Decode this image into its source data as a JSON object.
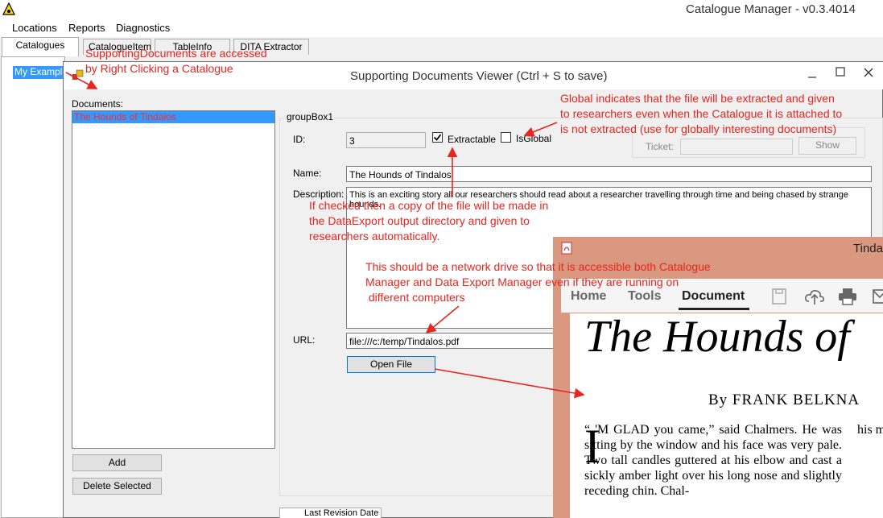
{
  "app": {
    "title": "Catalogue Manager - v0.3.4014",
    "menu": [
      "Locations",
      "Reports",
      "Diagnostics"
    ],
    "tabs": [
      "Catalogues",
      "CatalogueItem",
      "TableInfo",
      "DITA Extractor"
    ],
    "tree_item": "My Example"
  },
  "dialog": {
    "title": "Supporting Documents Viewer (Ctrl + S to save)",
    "documents_label": "Documents:",
    "documents": [
      "The Hounds of Tindalos"
    ],
    "add_label": "Add",
    "delete_label": "Delete Selected",
    "groupbox_label": "groupBox1",
    "id_label": "ID:",
    "id_value": "3",
    "extractable_label": "Extractable",
    "extractable_checked": true,
    "isglobal_label": "IsGlobal",
    "isglobal_checked": false,
    "ticket_label": "Ticket:",
    "ticket_value": "",
    "show_label": "Show",
    "name_label": "Name:",
    "name_value": "The Hounds of Tindalos",
    "description_label": "Description:",
    "description_value": "This is an exciting story all our researchers should read about a researcher travelling through time and being chased by strange hounds.",
    "url_label": "URL:",
    "url_value": "file:///c:/temp/Tindalos.pdf",
    "open_file_label": "Open File",
    "bottom_tab_label": "Last Revision Date"
  },
  "annotations": {
    "right_click": [
      "SupportingDocuments are accessed",
      "by Right Clicking a Catalogue"
    ],
    "global": [
      "Global indicates that the file will be extracted and given",
      "to researchers even when the Catalogue it is attached to",
      "is not extracted (use for globally interesting documents)"
    ],
    "extractable": [
      "If checked then a copy of the file will be made in",
      "the DataExport output directory and given to",
      "researchers automatically."
    ],
    "network": [
      "This should be a network drive so that it is accessible both Catalogue",
      "Manager and Data Export Manager even if they are running on",
      " different computers"
    ]
  },
  "pdf": {
    "window_title": "Tindalos",
    "tabs": [
      "Home",
      "Tools",
      "Document"
    ],
    "book_title": "The Hounds of",
    "byline": "By FRANK BELKNA",
    "drop_cap": "I",
    "body": "“    'M GLAD you came,” said Chalmers. He was sitting by the window and his face was very pale. Two tall candles guttered at his elbow and cast a sickly amber light over his long nose and slightly receding chin. Chal-",
    "col2": "his med lum the addi"
  },
  "colors": {
    "annotation": "#e8251f",
    "selection": "#3399ff"
  }
}
